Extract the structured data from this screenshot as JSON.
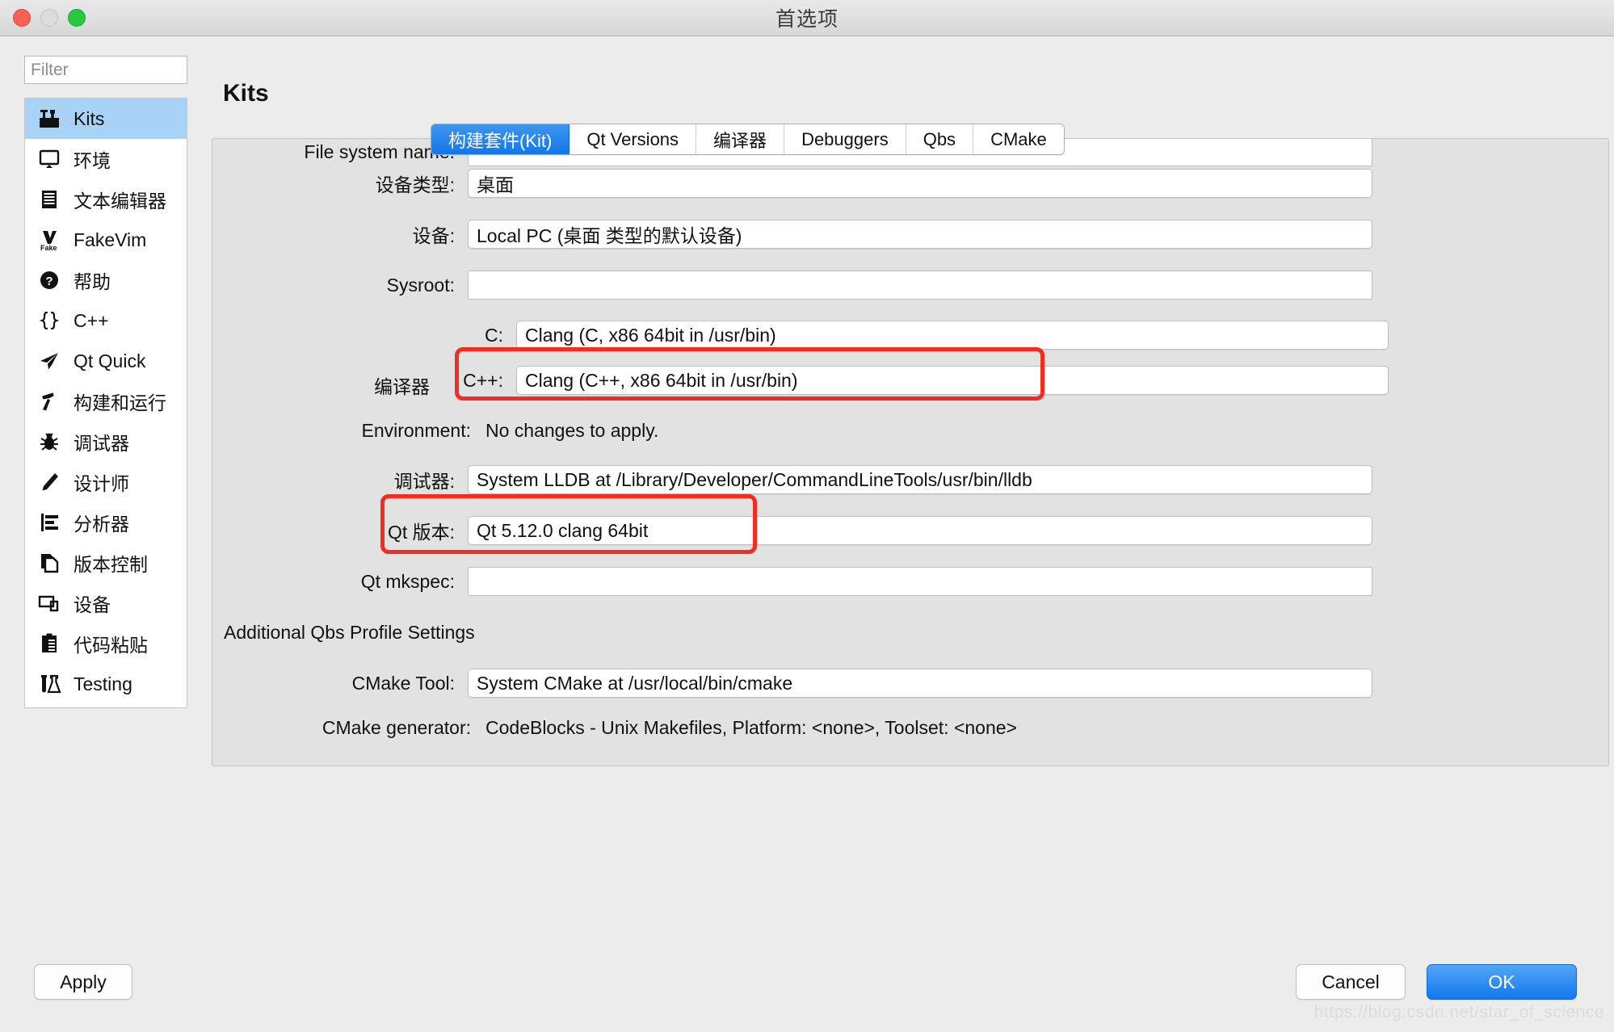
{
  "window": {
    "title": "首选项",
    "traffic_lights": [
      "close",
      "minimize",
      "maximize"
    ]
  },
  "sidebar": {
    "filter": {
      "placeholder": "Filter",
      "value": ""
    },
    "items": [
      {
        "label": "Kits",
        "icon": "kits-icon",
        "selected": true
      },
      {
        "label": "环境",
        "icon": "monitor-icon",
        "selected": false
      },
      {
        "label": "文本编辑器",
        "icon": "text-editor-icon",
        "selected": false
      },
      {
        "label": "FakeVim",
        "icon": "fakevim-icon",
        "selected": false
      },
      {
        "label": "帮助",
        "icon": "help-question-icon",
        "selected": false
      },
      {
        "label": "C++",
        "icon": "braces-icon",
        "selected": false
      },
      {
        "label": "Qt Quick",
        "icon": "paper-plane-icon",
        "selected": false
      },
      {
        "label": "构建和运行",
        "icon": "hammer-icon",
        "selected": false
      },
      {
        "label": "调试器",
        "icon": "bug-icon",
        "selected": false
      },
      {
        "label": "设计师",
        "icon": "pencil-icon",
        "selected": false
      },
      {
        "label": "分析器",
        "icon": "bar-analyzer-icon",
        "selected": false
      },
      {
        "label": "版本控制",
        "icon": "documents-copy-icon",
        "selected": false
      },
      {
        "label": "设备",
        "icon": "devices-icon",
        "selected": false
      },
      {
        "label": "代码粘贴",
        "icon": "clipboard-icon",
        "selected": false
      },
      {
        "label": "Testing",
        "icon": "flask-icon",
        "selected": false
      }
    ]
  },
  "main": {
    "page_title": "Kits",
    "tabs": [
      {
        "label": "构建套件(Kit)",
        "active": true
      },
      {
        "label": "Qt Versions",
        "active": false
      },
      {
        "label": "编译器",
        "active": false
      },
      {
        "label": "Debuggers",
        "active": false
      },
      {
        "label": "Qbs",
        "active": false
      },
      {
        "label": "CMake",
        "active": false
      }
    ],
    "form": {
      "file_system_name_label": "File system name:",
      "file_system_name_value": "",
      "device_type_label": "设备类型:",
      "device_type_value": "桌面",
      "device_label": "设备:",
      "device_value": "Local PC (桌面 类型的默认设备)",
      "sysroot_label": "Sysroot:",
      "sysroot_value": "",
      "compilers_group_label": "编译器",
      "compiler_c_label": "C:",
      "compiler_c_value": "Clang (C, x86 64bit in /usr/bin)",
      "compiler_cpp_label": "C++:",
      "compiler_cpp_value": "Clang (C++, x86 64bit in /usr/bin)",
      "environment_label": "Environment:",
      "environment_value": "No changes to apply.",
      "debugger_label": "调试器:",
      "debugger_value": "System LLDB at /Library/Developer/CommandLineTools/usr/bin/lldb",
      "qt_version_label": "Qt 版本:",
      "qt_version_value": "Qt 5.12.0 clang 64bit",
      "qt_mkspec_label": "Qt mkspec:",
      "qt_mkspec_value": "",
      "qbs_section_label": "Additional Qbs Profile Settings",
      "cmake_tool_label": "CMake Tool:",
      "cmake_tool_value": "System CMake at /usr/local/bin/cmake",
      "cmake_generator_label": "CMake generator:",
      "cmake_generator_value": "CodeBlocks - Unix Makefiles, Platform: <none>, Toolset: <none>"
    },
    "annotations": {
      "highlight_color": "#f42b20",
      "boxes": [
        "compiler-cpp-highlight",
        "qt-version-highlight"
      ]
    }
  },
  "footer": {
    "apply_label": "Apply",
    "cancel_label": "Cancel",
    "ok_label": "OK",
    "watermark": "https://blog.csdn.net/star_of_science"
  }
}
